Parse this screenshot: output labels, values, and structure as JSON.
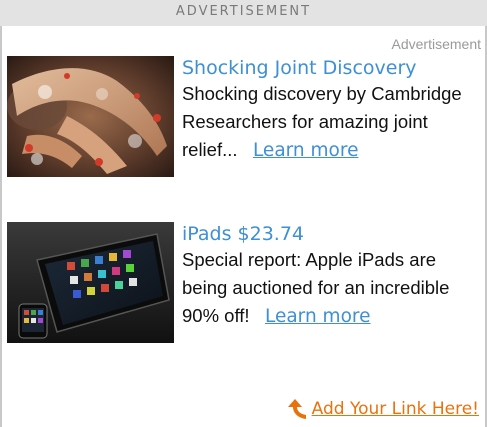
{
  "header": {
    "label": "ADVERTISEMENT"
  },
  "sponsor_label": "Advertisement",
  "ads": [
    {
      "title": "Shocking Joint Discovery",
      "description": "Shocking discovery by Cambridge Researchers for amazing joint relief...",
      "link_text": "Learn more",
      "image": "joint-pain-illustration"
    },
    {
      "title": "iPads $23.74",
      "description": "Special report: Apple iPads are being auctioned for an incredible 90% off!",
      "link_text": "Learn more",
      "image": "ipad-iphone-photo"
    }
  ],
  "footer": {
    "add_link_text": "Add Your Link Here!",
    "arrow_icon": "curved-arrow-icon"
  },
  "colors": {
    "header_bg": "#e3e3e3",
    "header_text": "#7a7a7a",
    "title_link": "#3d8fd6",
    "body_text": "#111111",
    "footer_link": "#e8720c",
    "border": "#c8c8c8"
  }
}
